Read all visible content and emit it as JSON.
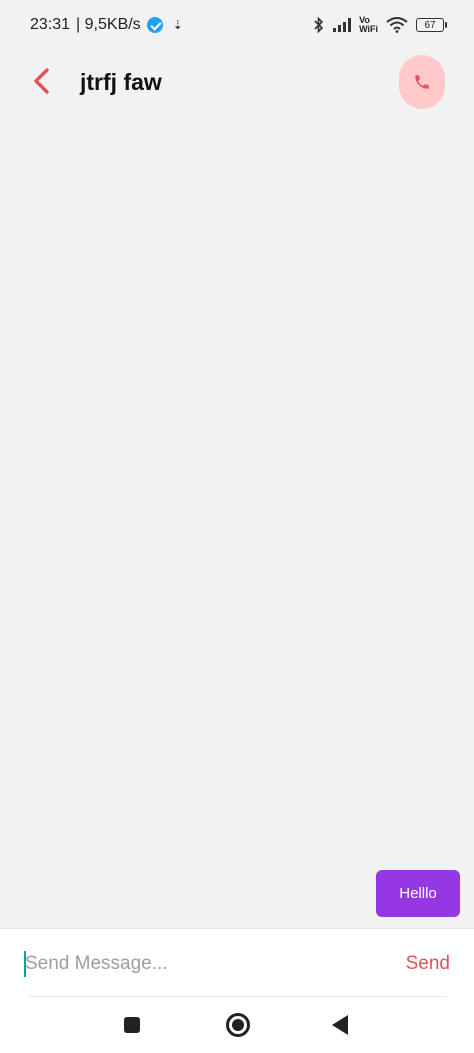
{
  "status_bar": {
    "time": "23:31",
    "network_speed": "| 9,5KB/s",
    "vowifi_top": "Vo",
    "vowifi_bottom": "WiFi",
    "battery": "67"
  },
  "header": {
    "title": "jtrfj faw",
    "back_icon": "chevron-left-icon",
    "call_icon": "phone-icon"
  },
  "messages": [
    {
      "text": "Helllo",
      "direction": "outgoing"
    }
  ],
  "composer": {
    "placeholder": "Send Message...",
    "value": "",
    "send_label": "Send"
  },
  "colors": {
    "accent": "#e5505a",
    "call_button_bg": "#ffc9cb",
    "bubble_bg": "#9637e6",
    "background": "#f2f2f2",
    "cursor": "#00a98f"
  },
  "nav_bar": {
    "icons": [
      "recent-apps-icon",
      "home-icon",
      "back-triangle-icon"
    ]
  }
}
